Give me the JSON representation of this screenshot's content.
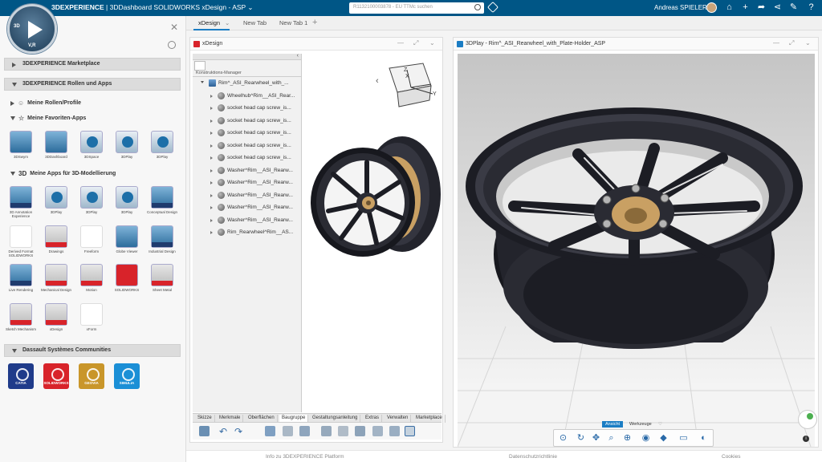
{
  "topbar": {
    "brand_bold": "3DEXPERIENCE",
    "brand_rest": " | 3DDashboard  SOLIDWORKS xDesign - ASP",
    "brand_chevron": "⌄",
    "search_placeholder": "R1132100003878 - EU TTMc suchen",
    "user_name": "Andreas SPIELER"
  },
  "compass": {
    "label_3d": "3D",
    "label_vr": "V,R"
  },
  "left_panel": {
    "marketplace": "3DEXPERIENCE Marketplace",
    "roles_apps": "3DEXPERIENCE Rollen und Apps",
    "my_roles": "Meine Rollen/Profile",
    "my_favorites": "Meine Favoriten-Apps",
    "my_3d_apps": "Meine Apps für 3D-Modellierung",
    "communities": "Dassault Systèmes Communities",
    "favorites": [
      "3DSwym",
      "3DDashboard",
      "3DSpace",
      "3DPlay",
      "3DPlay"
    ],
    "apps": [
      "3D Annotation Experience",
      "3DPlay",
      "3DPlay",
      "3DPlay",
      "Conceptual Design",
      "Derived Format SOLIDWORKS",
      "Drawings",
      "Freeform",
      "Globe Viewer",
      "Industrial Design",
      "Live Rendering",
      "Mechanical Design",
      "Motion",
      "SOLIDWORKS",
      "Sheet Metal",
      "Sketch Mechanism",
      "xDesign",
      "xForm"
    ],
    "community_tiles": [
      "CATIA",
      "SOLIDWORKS",
      "GEOVIA",
      "SIMULIA"
    ]
  },
  "tabs": [
    {
      "label": "xDesign",
      "active": true
    },
    {
      "label": "New Tab"
    },
    {
      "label": "New Tab 1"
    }
  ],
  "tab_add": "+",
  "xdesign": {
    "title": "xDesign",
    "tree_header": "Konstruktions-Manager",
    "tree_rows": [
      "Rim^_ASI_Rearwheel_with_...",
      "Wheelhub^Rim__ASI_Rear...",
      "socket head cap screw_is...",
      "socket head cap screw_is...",
      "socket head cap screw_is...",
      "socket head cap screw_is...",
      "socket head cap screw_is...",
      "Washer^Rim__ASI_Rearw...",
      "Washer^Rim__ASI_Rearw...",
      "Washer^Rim__ASI_Rearw...",
      "Washer^Rim__ASI_Rearw...",
      "Washer^Rim__ASI_Rearw...",
      "Rim_Rearwheel^Rim__AS..."
    ],
    "bottom_tabs": [
      "Skizze",
      "Merkmale",
      "Oberflächen",
      "Baugruppe",
      "Gestaltungsanleitung",
      "Extras",
      "Verwalten",
      "Marketplace"
    ],
    "active_bottom_tab": "Baugruppe",
    "axis_x": "X",
    "axis_y": "Y",
    "axis_z": "Z"
  },
  "play": {
    "title": "3DPlay - Rim^_ASI_Rearwheel_with_Plate-Holder_ASP",
    "tabs": [
      "Ansicht",
      "Werkzeuge"
    ]
  },
  "footer": {
    "info": "Info zu 3DEXPERIENCE Platform",
    "privacy": "Datenschutzrichtlinie",
    "cookies": "Cookies"
  },
  "colors": {
    "topbar": "#005686",
    "accent": "#1b7dc4",
    "rim": "#1c1d24",
    "hub": "#c9a063"
  }
}
